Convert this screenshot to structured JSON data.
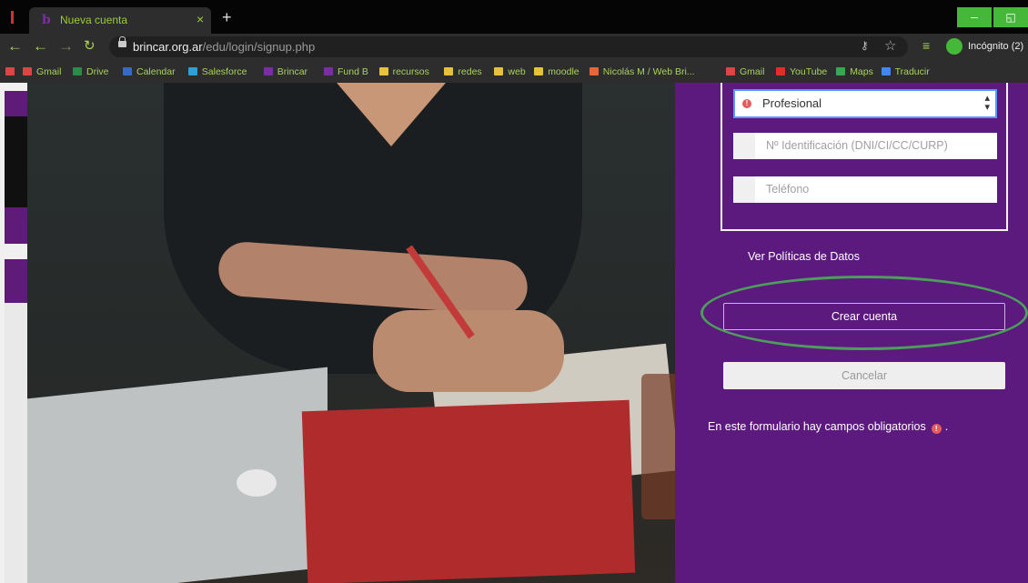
{
  "browser": {
    "tab_title": "Nueva cuenta",
    "tab_favicon": "b",
    "tab_close": "×",
    "new_tab": "+",
    "url_domain": "brincar.org.ar",
    "url_path": "/edu/login/signup.php",
    "incognito_label": "Incógnito (2)",
    "window_minimize": "–",
    "window_restore": "◱"
  },
  "bookmarks": [
    {
      "label": "",
      "color": "#d44"
    },
    {
      "label": "Gmail",
      "color": "#d44"
    },
    {
      "label": "Drive",
      "color": "#2c8c4a"
    },
    {
      "label": "Calendar",
      "color": "#3a68c9"
    },
    {
      "label": "Salesforce",
      "color": "#2ea0d8"
    },
    {
      "label": "Brincar",
      "color": "#7a2ea0"
    },
    {
      "label": "Fund B",
      "color": "#7a2ea0"
    },
    {
      "label": "recursos",
      "color": "#e6c13b"
    },
    {
      "label": "redes",
      "color": "#e6c13b"
    },
    {
      "label": "web",
      "color": "#e6c13b"
    },
    {
      "label": "moodle",
      "color": "#e6c13b"
    },
    {
      "label": "Nicolás M / Web Bri...",
      "color": "#e8643c"
    },
    {
      "label": "Gmail",
      "color": "#d44"
    },
    {
      "label": "YouTube",
      "color": "#e52d27"
    },
    {
      "label": "Maps",
      "color": "#34a853"
    },
    {
      "label": "Traducir",
      "color": "#4285f4"
    }
  ],
  "form": {
    "profile_select_value": "Profesional",
    "id_placeholder": "Nº Identificación (DNI/CI/CC/CURP)",
    "phone_placeholder": "Teléfono",
    "policy_link": "Ver Políticas de Datos",
    "create_button": "Crear cuenta",
    "cancel_button": "Cancelar",
    "required_note": "En este formulario hay campos obligatorios",
    "required_note_suffix": ".",
    "required_mark": "!"
  },
  "colors": {
    "panel": "#5d1a7e",
    "annotation_oval": "#4b9f5a",
    "browser_accent": "#a9d35b"
  }
}
